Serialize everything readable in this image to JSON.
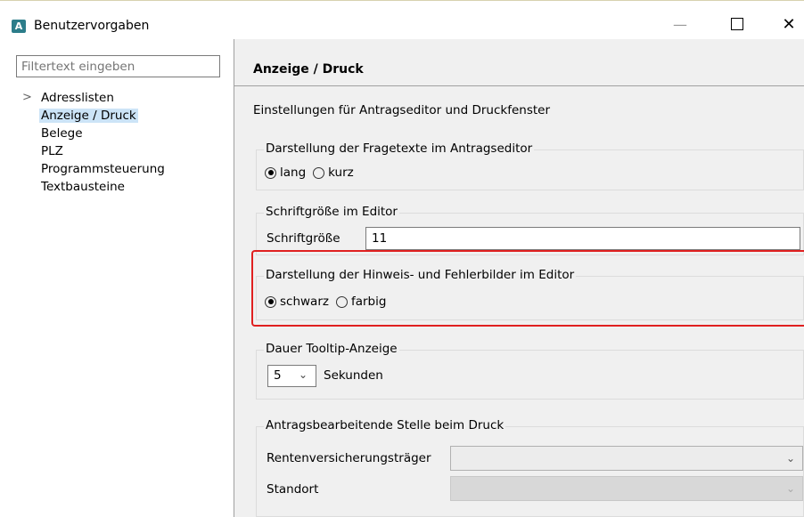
{
  "window": {
    "title": "Benutzervorgaben",
    "app_icon_letter": "A",
    "minimize": "—",
    "close": "✕"
  },
  "sidebar": {
    "filter_placeholder": "Filtertext eingeben",
    "items": [
      {
        "label": "Adresslisten",
        "expandable": true
      },
      {
        "label": "Anzeige / Druck",
        "selected": true
      },
      {
        "label": "Belege"
      },
      {
        "label": "PLZ"
      },
      {
        "label": "Programmsteuerung"
      },
      {
        "label": "Textbausteine"
      }
    ]
  },
  "page": {
    "title": "Anzeige / Druck",
    "description": "Einstellungen für Antragseditor und Druckfenster",
    "groups": {
      "fragetexte": {
        "legend": "Darstellung der Fragetexte im Antragseditor",
        "options": [
          "lang",
          "kurz"
        ],
        "selected": "lang"
      },
      "schriftgroesse": {
        "legend": "Schriftgröße im Editor",
        "label": "Schriftgröße",
        "value": "11"
      },
      "bilder": {
        "legend": "Darstellung der Hinweis- und Fehlerbilder im Editor",
        "options": [
          "schwarz",
          "farbig"
        ],
        "selected": "schwarz"
      },
      "tooltip": {
        "legend": "Dauer Tooltip-Anzeige",
        "value": "5",
        "unit": "Sekunden"
      },
      "druck": {
        "legend": "Antragsbearbeitende Stelle beim Druck",
        "traeger_label": "Rentenversicherungsträger",
        "standort_label": "Standort"
      }
    }
  },
  "colors": {
    "highlight": "#e02020",
    "selection": "#cce4f7",
    "panel": "#f0f0f0"
  }
}
